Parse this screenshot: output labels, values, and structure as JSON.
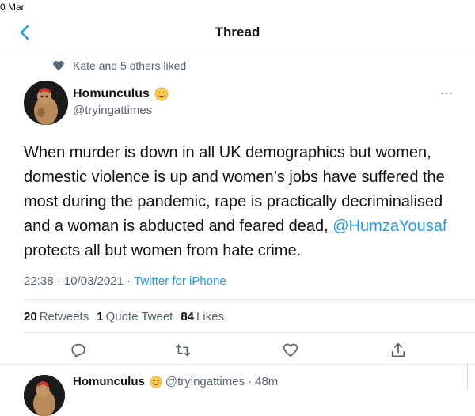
{
  "status_bar": {
    "time_fragment": "0 Mar"
  },
  "nav": {
    "title": "Thread",
    "back_icon": "chevron-left-icon"
  },
  "social_context": {
    "text": "Kate and 5 others liked",
    "icon": "heart-icon"
  },
  "tweet": {
    "display_name": "Homunculus",
    "emoji": "blushing-face-emoji",
    "handle": "@tryingattimes",
    "text_before_mention": "When murder is down in all UK demographics but women, domestic violence is up and women’s jobs have suffered the most during the pandemic, rape is practically decriminalised and a woman is abducted and feared dead, ",
    "mention": "@HumzaYousaf",
    "text_after_mention": " protects all but women from hate crime.",
    "time": "22:38",
    "date": "10/03/2021",
    "separator": "·",
    "source": "Twitter for iPhone"
  },
  "stats": {
    "retweets_count": "20",
    "retweets_label": "Retweets",
    "quotes_count": "1",
    "quotes_label": "Quote Tweet",
    "likes_count": "84",
    "likes_label": "Likes"
  },
  "actions": [
    "reply-icon",
    "retweet-icon",
    "like-icon",
    "share-icon"
  ],
  "reply": {
    "display_name": "Homunculus",
    "handle": "@tryingattimes",
    "separator": "·",
    "age": "48m"
  },
  "colors": {
    "link": "#1d9bf0",
    "secondary": "#536471",
    "divider": "#e6e6e6"
  }
}
